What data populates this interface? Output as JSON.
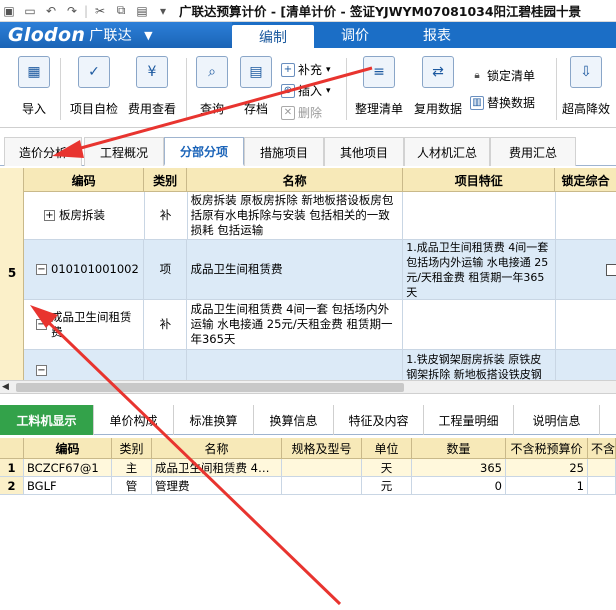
{
  "titlebar": {
    "title": "广联达预算计价 - [清单计价 - 签证YJWYM07081034阳江碧桂园十景"
  },
  "ribbon_tabs": {
    "logo": "Glodon",
    "logo_cn": "广联达",
    "tabs": [
      "编制",
      "调价",
      "报表"
    ],
    "active": "编制"
  },
  "ribbon": {
    "import": "导入",
    "self_check": "项目自检",
    "fee_view": "费用查看",
    "query": "查询",
    "save": "存档",
    "supplement": "补充",
    "insert": "插入",
    "delete": "删除",
    "organize": "整理清单",
    "reuse": "复用数据",
    "lock_list": "锁定清单",
    "replace_data": "替换数据",
    "reduce": "超高降效"
  },
  "page_tabs": [
    "造价分析",
    "工程概况",
    "分部分项",
    "措施项目",
    "其他项目",
    "人材机汇总",
    "费用汇总"
  ],
  "main_grid": {
    "columns": [
      "编码",
      "类别",
      "名称",
      "项目特征",
      "锁定综合"
    ],
    "row_number": "5",
    "rows": [
      {
        "code": "板房拆装",
        "type": "补",
        "name": "板房拆装 原板房拆除 新地板搭设板房包括原有水电拆除与安装 包括相关的一致损耗 包括运输",
        "feature": "",
        "toggle": "+"
      },
      {
        "code": "010101001002",
        "type": "项",
        "name": "成品卫生间租赁费",
        "feature": "1.成品卫生间租赁费 4间一套 包括场内外运输 水电接通 25元/天租金费 租赁期一年365天",
        "toggle": "−"
      },
      {
        "code": "成品卫生间租赁费",
        "type": "补",
        "name": "成品卫生间租赁费 4间一套 包括场内外运输 水电接通 25元/天租金费 租赁期一年365天",
        "feature": "",
        "toggle": "−"
      },
      {
        "code": "",
        "type": "",
        "name": "",
        "feature": "1.铁皮钢架厨房拆装 原铁皮钢架拆除 新地板搭设铁皮钢",
        "toggle": "−"
      }
    ]
  },
  "bottom_tabs": [
    "工料机显示",
    "单价构成",
    "标准换算",
    "换算信息",
    "特征及内容",
    "工程量明细",
    "说明信息"
  ],
  "bottom_grid": {
    "columns": [
      "编码",
      "类别",
      "名称",
      "规格及型号",
      "单位",
      "数量",
      "不含税预算价",
      "不含"
    ],
    "rows": [
      {
        "n": "1",
        "code": "BCZCF67@1",
        "type": "主",
        "name": "成品卫生间租赁费 4…",
        "spec": "",
        "unit": "天",
        "qty": "365",
        "price": "25"
      },
      {
        "n": "2",
        "code": "BGLF",
        "type": "管",
        "name": "管理费",
        "spec": "",
        "unit": "元",
        "qty": "0",
        "price": "1"
      }
    ]
  },
  "colors": {
    "ribbon_blue": "#1b6ec6",
    "active_green": "#33a24a",
    "annotation_red": "#e8342f",
    "header_yellow": "#f7e9b8"
  }
}
